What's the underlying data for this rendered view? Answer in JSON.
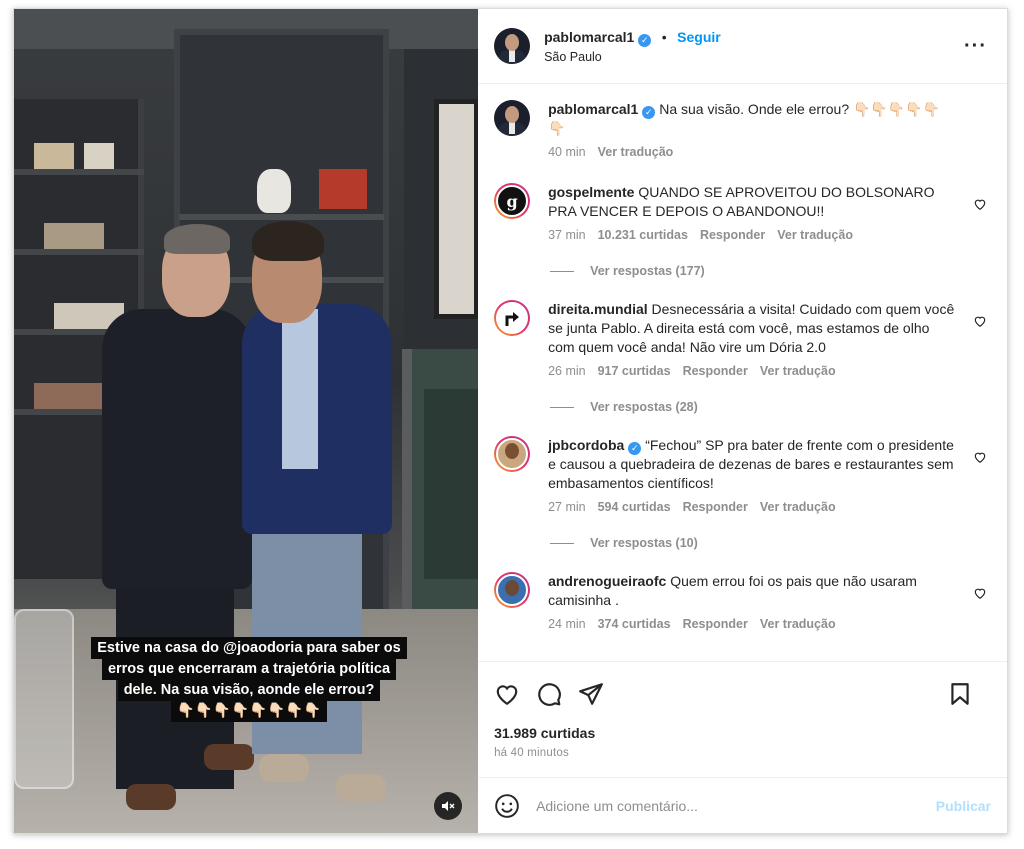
{
  "post": {
    "username": "pablomarcal1",
    "follow_label": "Seguir",
    "separator": "•",
    "location": "São Paulo",
    "caption_lines": [
      "Estive na casa do @joaodoria para saber os",
      "erros que encerraram a trajetória política",
      "dele. Na sua visão, aonde ele errou?",
      "👇🏻👇🏻👇🏻👇🏻👇🏻👇🏻👇🏻👇🏻"
    ],
    "author_comment": {
      "username": "pablomarcal1",
      "text": "Na sua visão. Onde ele errou? 👇🏻👇🏻👇🏻👇🏻👇🏻👇🏻",
      "time": "40 min",
      "translate": "Ver tradução"
    }
  },
  "comments": [
    {
      "username": "gospelmente",
      "text": "QUANDO SE APROVEITOU DO BOLSONARO PRA VENCER E DEPOIS O ABANDONOU!!",
      "time": "37 min",
      "likes": "10.231 curtidas",
      "reply": "Responder",
      "translate": "Ver tradução",
      "replies": "Ver respostas (177)"
    },
    {
      "username": "direita.mundial",
      "text": "Desnecessária a visita! Cuidado com quem você se junta Pablo. A direita está com você, mas estamos de olho com quem você anda! Não vire um Dória 2.0",
      "time": "26 min",
      "likes": "917 curtidas",
      "reply": "Responder",
      "translate": "Ver tradução",
      "replies": "Ver respostas (28)"
    },
    {
      "username": "jpbcordoba",
      "text": "“Fechou” SP pra bater de frente com o presidente e causou a quebradeira de dezenas de bares e restaurantes sem embasamentos científicos!",
      "time": "27 min",
      "likes": "594 curtidas",
      "reply": "Responder",
      "translate": "Ver tradução",
      "replies": "Ver respostas (10)"
    },
    {
      "username": "andrenogueiraofc",
      "text": "Quem errou foi os pais que não usaram camisinha .",
      "time": "24 min",
      "likes": "374 curtidas",
      "reply": "Responder",
      "translate": "Ver tradução"
    }
  ],
  "footer": {
    "likes": "31.989 curtidas",
    "time": "há 40 minutos",
    "comment_placeholder": "Adicione um comentário...",
    "publish_label": "Publicar"
  },
  "colors": {
    "accent": "#0095f6",
    "verified": "#3897f0",
    "muted": "#8e8e8e"
  },
  "icons": [
    "more-icon",
    "verified-icon",
    "heart-icon",
    "comment-icon",
    "share-icon",
    "bookmark-icon",
    "emoji-icon",
    "mute-icon"
  ]
}
